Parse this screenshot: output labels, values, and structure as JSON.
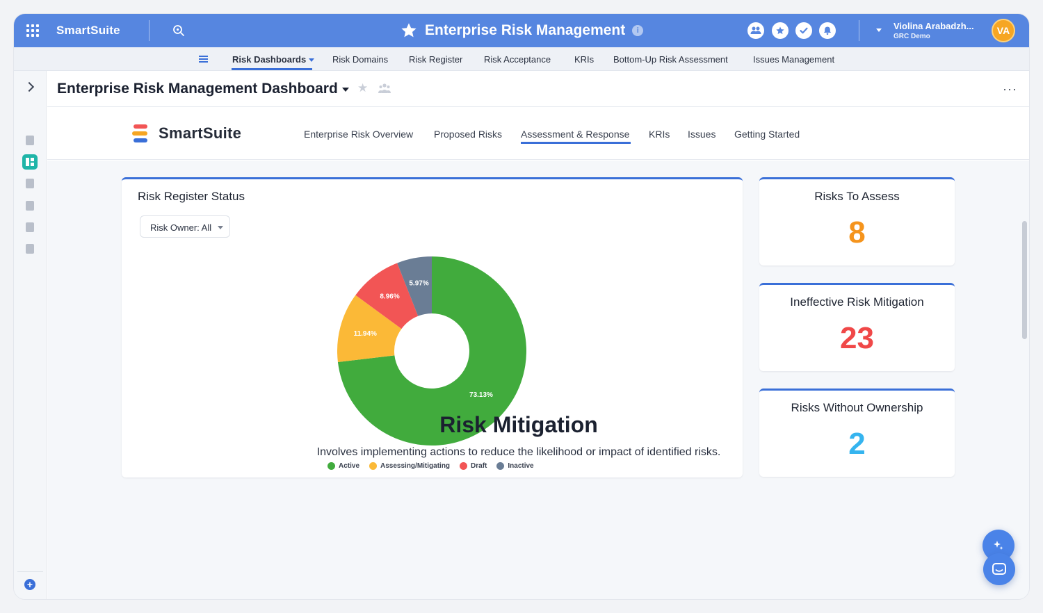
{
  "topbar": {
    "brand": "SmartSuite",
    "app_title": "Enterprise Risk Management",
    "user_name": "Violina Arabadzh...",
    "user_org": "GRC Demo",
    "avatar_initials": "VA",
    "accent": "#5686e0"
  },
  "subnav": {
    "items": [
      {
        "label": "Risk Dashboards"
      },
      {
        "label": "Risk Domains"
      },
      {
        "label": "Risk Register"
      },
      {
        "label": "Risk Acceptance"
      },
      {
        "label": "KRIs"
      },
      {
        "label": "Bottom-Up Risk Assessment"
      },
      {
        "label": "Issues Management"
      }
    ]
  },
  "page": {
    "title": "Enterprise Risk Management Dashboard"
  },
  "dashboard": {
    "brand": "SmartSuite",
    "tabs": [
      {
        "label": "Enterprise Risk Overview"
      },
      {
        "label": "Proposed Risks"
      },
      {
        "label": "Assessment & Response"
      },
      {
        "label": "KRIs"
      },
      {
        "label": "Issues"
      },
      {
        "label": "Getting Started"
      }
    ],
    "active_tab": "Assessment & Response"
  },
  "status_card": {
    "title": "Risk Register Status",
    "filter_label": "Risk Owner: All"
  },
  "chart_data": {
    "type": "pie",
    "donut": true,
    "title": "Risk Register Status",
    "legend_position": "bottom",
    "slices": [
      {
        "name": "Active",
        "value": 73.13,
        "label": "73.13%",
        "color": "#41ab3d"
      },
      {
        "name": "Assessing/Mitigating",
        "value": 11.94,
        "label": "11.94%",
        "color": "#fbb937"
      },
      {
        "name": "Draft",
        "value": 8.96,
        "label": "8.96%",
        "color": "#f25555"
      },
      {
        "name": "Inactive",
        "value": 5.97,
        "label": "5.97%",
        "color": "#6a7d95"
      }
    ]
  },
  "kpis": [
    {
      "title": "Risks To Assess",
      "value": "8",
      "color": "#f5941d"
    },
    {
      "title": "Ineffective Risk Mitigation",
      "value": "23",
      "color": "#f04848"
    },
    {
      "title": "Risks Without Ownership",
      "value": "2",
      "color": "#35b4ef"
    }
  ],
  "section": {
    "title": "Risk Mitigation",
    "subtitle": "Involves implementing actions to reduce the likelihood or impact of identified risks."
  }
}
